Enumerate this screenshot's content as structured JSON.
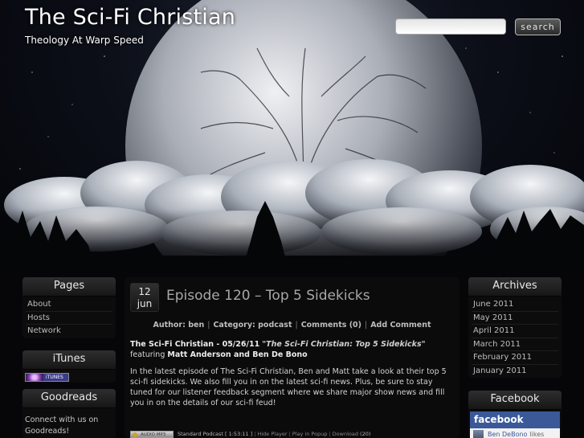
{
  "site": {
    "title": "The Sci-Fi Christian",
    "tagline": "Theology At Warp Speed",
    "search_placeholder": "",
    "search_button": "search"
  },
  "sidebar_left": {
    "pages_title": "Pages",
    "pages": [
      "About",
      "Hosts",
      "Network"
    ],
    "itunes_title": "iTunes",
    "itunes_badge_text": "iTUNES",
    "goodreads_title": "Goodreads",
    "goodreads_text": "Connect with us on Goodreads!"
  },
  "sidebar_right": {
    "archives_title": "Archives",
    "archives": [
      "June 2011",
      "May 2011",
      "April 2011",
      "March 2011",
      "February 2011",
      "January 2011"
    ],
    "facebook_title": "Facebook",
    "facebook_logo": "facebook",
    "facebook_user": "Ben DeBono",
    "facebook_likes": "likes"
  },
  "post": {
    "date_day": "12",
    "date_month": "jun",
    "title": "Episode 120 – Top 5 Sidekicks",
    "meta_author": "Author: ben",
    "meta_category": "Category: podcast",
    "meta_comments": "Comments (0)",
    "meta_add_comment": "Add Comment",
    "intro_show": "The Sci-Fi Christian - 05/26/11",
    "intro_quote": "\"The Sci-Fi Christian: Top 5 Sidekicks\"",
    "intro_featuring": "featuring",
    "intro_hosts": "Matt Anderson and Ben De Bono",
    "body": "In the latest episode of The Sci-Fi Christian, Ben and Matt take a look at their top 5 sci-fi sidekicks. We also fill you in on the latest sci-fi news. Plus, be sure to stay tuned for our listener feedback segment where we share major show news and fill you in on the details of our sci-fi feud!",
    "player": {
      "badge": "AUDIO MP3",
      "label": "Standard Podcast",
      "duration": "[ 1:53:11 ]",
      "hide_player": "Hide Player",
      "play_popup": "Play in Popup",
      "download": "Download",
      "download_count": "(20)"
    }
  }
}
